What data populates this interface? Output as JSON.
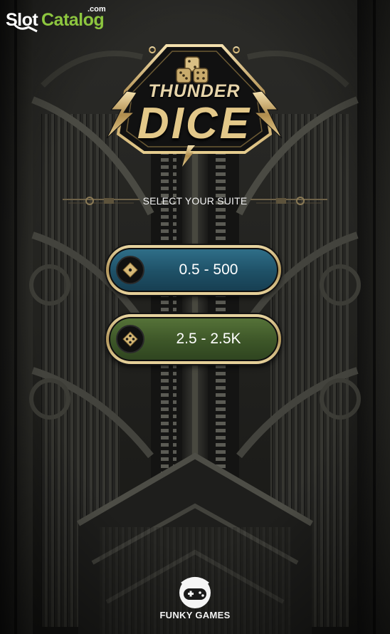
{
  "watermark": {
    "slot": "Slot",
    "catalog": "Catalog",
    "com": ".com"
  },
  "logo": {
    "line1": "THUNDER",
    "line2": "DICE"
  },
  "heading": "SELECT YOUR SUITE",
  "suites": [
    {
      "range": "0.5 - 500",
      "icon": "die-one-pip-icon",
      "color": "#1e5066"
    },
    {
      "range": "2.5 - 2.5K",
      "icon": "die-four-pip-icon",
      "color": "#3d5628"
    }
  ],
  "footer": {
    "brand": "FUNKY GAMES",
    "icon": "gamepad-mascot-icon"
  },
  "colors": {
    "gold": "#c9aa6a",
    "background": "#1a1a18",
    "watermark_green": "#8dc63f"
  }
}
